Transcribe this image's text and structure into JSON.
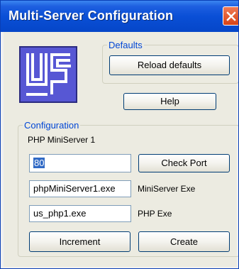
{
  "window": {
    "title": "Multi-Server Configuration"
  },
  "logo": {
    "text": "US"
  },
  "defaults": {
    "legend": "Defaults",
    "reload_label": "Reload defaults"
  },
  "help_label": "Help",
  "configuration": {
    "legend": "Configuration",
    "server_name": "PHP MiniServer 1",
    "port_value": "80",
    "check_port_label": "Check Port",
    "miniserver_exe_value": "phpMiniServer1.exe",
    "miniserver_exe_label": "MiniServer Exe",
    "php_exe_value": "us_php1.exe",
    "php_exe_label": "PHP Exe",
    "increment_label": "Increment",
    "create_label": "Create"
  },
  "colors": {
    "titlebar": "#0a4fd6",
    "legend_text": "#0046d5",
    "logo_background": "#5757d4",
    "close_button": "#d84315"
  },
  "icons": {
    "close": "close-icon"
  }
}
